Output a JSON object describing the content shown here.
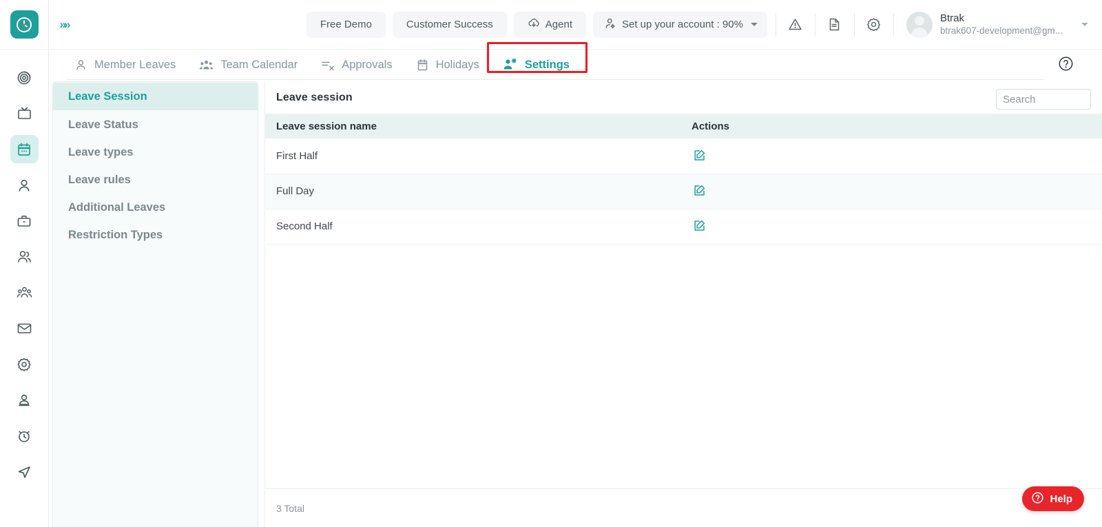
{
  "app": {
    "logo_icon": "clock-logo-icon",
    "expand_arrows": "»»",
    "accent_color": "#1f9f9a",
    "danger_color": "#e8252b",
    "highlight_color": "#ed1c24"
  },
  "header": {
    "buttons": [
      {
        "label": "Free Demo",
        "icon": null
      },
      {
        "label": "Customer Success",
        "icon": null
      },
      {
        "label": "Agent",
        "icon": "download-cloud-icon"
      }
    ],
    "setup": {
      "label": "Set up your account : 90%",
      "icon": "person-gear-icon",
      "percent": "90%"
    },
    "icons": [
      {
        "name": "warning-triangle-icon"
      },
      {
        "name": "document-icon"
      },
      {
        "name": "gear-icon"
      }
    ],
    "user": {
      "name": "Btrak",
      "email": "btrak607-development@gm...",
      "avatar": "user-avatar"
    }
  },
  "tabs": [
    {
      "label": "Member Leaves",
      "icon": "person-icon",
      "active": false
    },
    {
      "label": "Team Calendar",
      "icon": "group-icon",
      "active": false
    },
    {
      "label": "Approvals",
      "icon": "list-check-icon",
      "active": false
    },
    {
      "label": "Holidays",
      "icon": "calendar-icon",
      "active": false
    },
    {
      "label": "Settings",
      "icon": "people-gear-icon",
      "active": true
    }
  ],
  "tab_help_icon": "help-circle-icon",
  "rail": {
    "items": [
      {
        "icon": "spiral-target-icon",
        "active": false
      },
      {
        "icon": "tv-monitor-icon",
        "active": false
      },
      {
        "icon": "calendar-icon",
        "active": true
      },
      {
        "icon": "person-icon",
        "active": false
      },
      {
        "icon": "briefcase-icon",
        "active": false
      },
      {
        "icon": "users-icon",
        "active": false
      },
      {
        "icon": "team-group-icon",
        "active": false
      },
      {
        "icon": "mail-icon",
        "active": false
      },
      {
        "icon": "gear-icon",
        "active": false
      },
      {
        "icon": "person-card-icon",
        "active": false
      },
      {
        "icon": "alarm-clock-icon",
        "active": false
      },
      {
        "icon": "send-paper-plane-icon",
        "active": false
      }
    ]
  },
  "subnav": {
    "items": [
      {
        "label": "Leave Session",
        "active": true
      },
      {
        "label": "Leave Status",
        "active": false
      },
      {
        "label": "Leave types",
        "active": false
      },
      {
        "label": "Leave rules",
        "active": false
      },
      {
        "label": "Additional Leaves",
        "active": false
      },
      {
        "label": "Restriction Types",
        "active": false
      }
    ]
  },
  "main": {
    "title": "Leave session",
    "search": {
      "placeholder": "Search",
      "value": ""
    },
    "table": {
      "columns": [
        "Leave session name",
        "Actions"
      ],
      "rows": [
        {
          "name": "First Half",
          "action_icon": "edit-icon"
        },
        {
          "name": "Full Day",
          "action_icon": "edit-icon"
        },
        {
          "name": "Second Half",
          "action_icon": "edit-icon"
        }
      ]
    },
    "total_label": "3 Total"
  },
  "help_widget": {
    "label": "Help",
    "icon": "question-circle-icon"
  }
}
